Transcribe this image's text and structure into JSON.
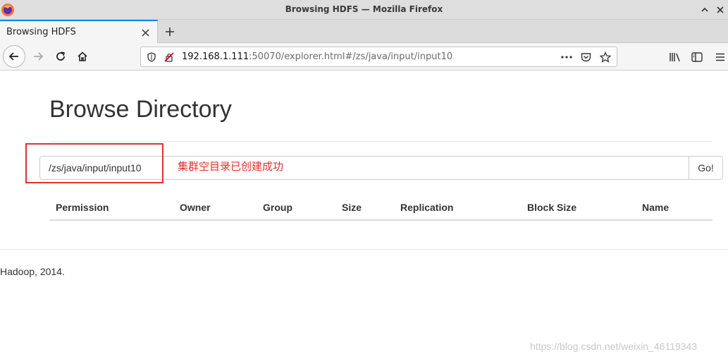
{
  "window": {
    "title": "Browsing HDFS — Mozilla Firefox",
    "buttons": {
      "collapse_icon": "chevron-up-icon",
      "close_icon": "close-icon"
    }
  },
  "tabs": [
    {
      "label": "Browsing HDFS",
      "active": true
    }
  ],
  "navbar": {
    "url_host": "192.168.1.111",
    "url_rest": ":50070/explorer.html#/zs/java/input/input10",
    "icons": [
      "back-icon",
      "forward-icon",
      "reload-icon",
      "home-icon",
      "shield-icon",
      "insecure-lock-icon",
      "page-actions-icon",
      "pocket-icon",
      "bookmark-star-icon",
      "library-icon",
      "sidebar-icon",
      "menu-icon"
    ]
  },
  "page": {
    "title": "Browse Directory",
    "path_value": "/zs/java/input/input10",
    "go_label": "Go!",
    "annotation": "集群空目录已创建成功",
    "columns": [
      "Permission",
      "Owner",
      "Group",
      "Size",
      "Replication",
      "Block Size",
      "Name"
    ],
    "rows": [],
    "footer": "Hadoop, 2014."
  },
  "watermark": "https://blog.csdn.net/weixin_46119343",
  "colors": {
    "accent_blue": "#0a84ff",
    "annotation_red": "#e03131"
  }
}
